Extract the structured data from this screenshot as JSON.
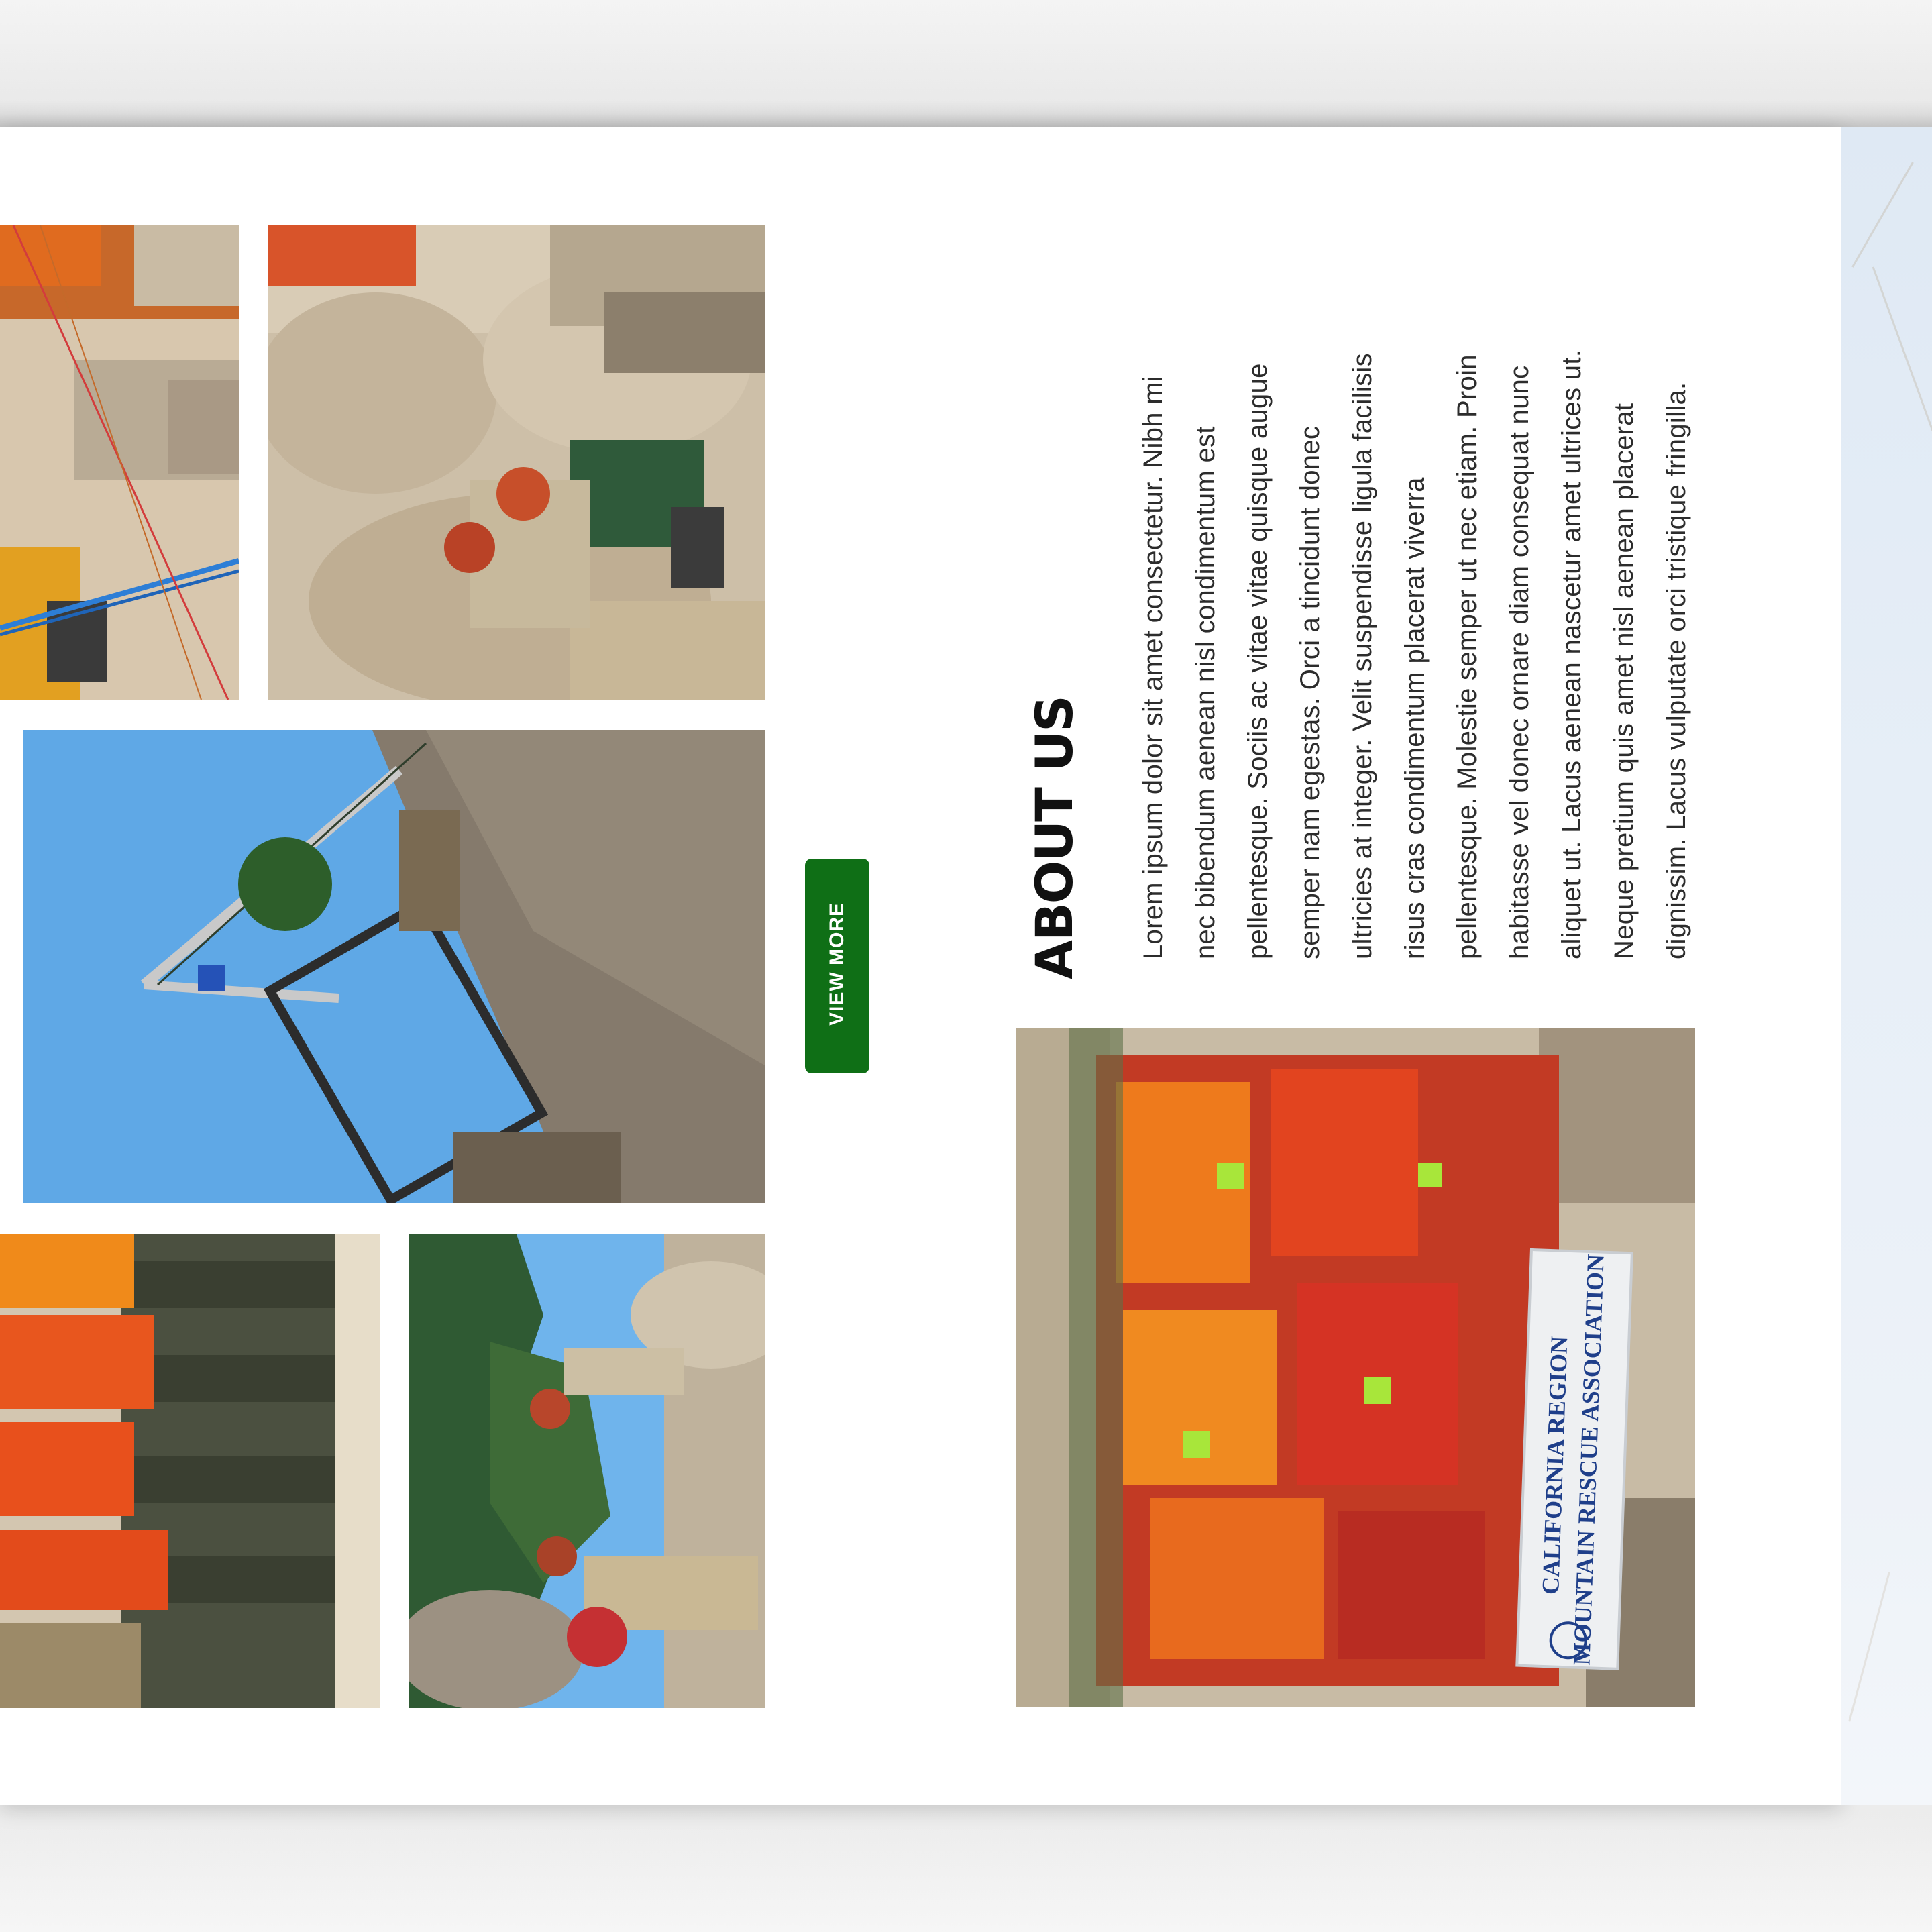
{
  "about": {
    "title": "ABOUT US",
    "paragraph_lines": [
      "Lorem ipsum dolor sit amet consectetur. Nibh mi",
      "nec bibendum aenean nisl condimentum est",
      "pellentesque. Sociis ac vitae vitae quisque augue",
      "semper nam egestas. Orci a tincidunt donec",
      "ultricies at integer. Velit suspendisse ligula facilisis",
      "risus cras condimentum placerat viverra",
      "pellentesque. Molestie semper ut nec etiam. Proin",
      "habitasse vel donec ornare diam consequat nunc",
      "aliquet ut. Lacus aenean nascetur amet ultrices ut.",
      "Neque pretium quis amet nisl aenean placerat",
      "dignissim. Lacus vulputate orci tristique fringilla."
    ]
  },
  "gallery": {
    "view_more_label": "VIEW MORE"
  },
  "group_photo": {
    "banner_line1": "CALIFORNIA REGION",
    "banner_line2": "MOUNTAIN RESCUE ASSOCIATION"
  },
  "colors": {
    "button_green": "#0f6f16",
    "page_background": "#ffffff",
    "text_dark": "#2c2c2c"
  }
}
